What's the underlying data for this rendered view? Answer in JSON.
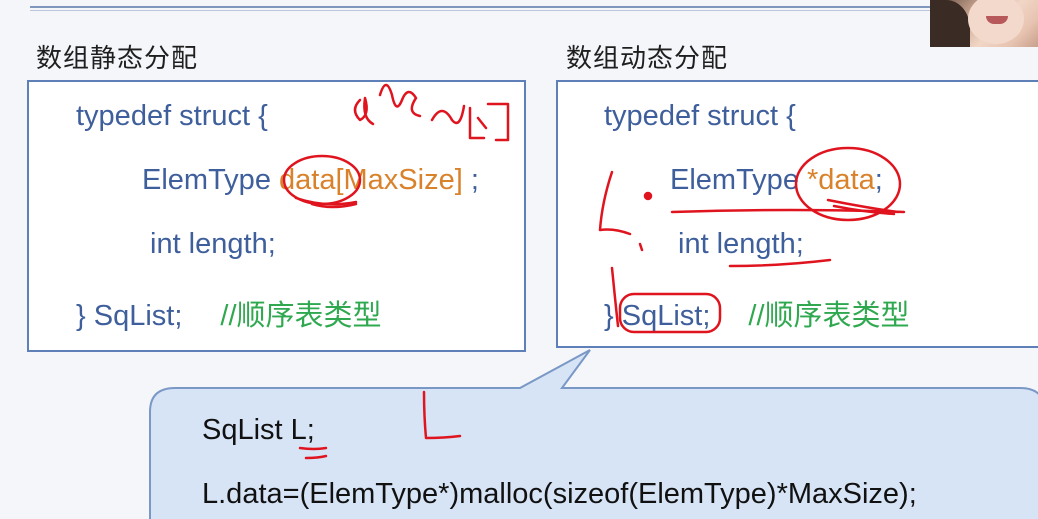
{
  "static_section": {
    "title": "数组静态分配",
    "line1": "typedef struct {",
    "line2_type": "ElemType ",
    "line2_field": "data",
    "line2_size": "[MaxSize]",
    "line2_end": " ;",
    "line3": "int length;",
    "line4_code": "} SqList;",
    "line4_comment": "//顺序表类型"
  },
  "dynamic_section": {
    "title": "数组动态分配",
    "line1": "typedef struct {",
    "line2_type": "ElemType ",
    "line2_field": "*data",
    "line2_end": ";",
    "line3": "int length;",
    "line4_code": "} SqList;",
    "line4_comment": "//顺序表类型"
  },
  "callout": {
    "line1": "SqList L;",
    "line2": "L.data=(ElemType*)malloc(sizeof(ElemType)*MaxSize);"
  },
  "colors": {
    "code_blue": "#3e5f9c",
    "field_orange": "#d9822b",
    "comment_green": "#2fa84f",
    "box_border": "#5f7fb8",
    "ink_red": "#e0141e"
  }
}
